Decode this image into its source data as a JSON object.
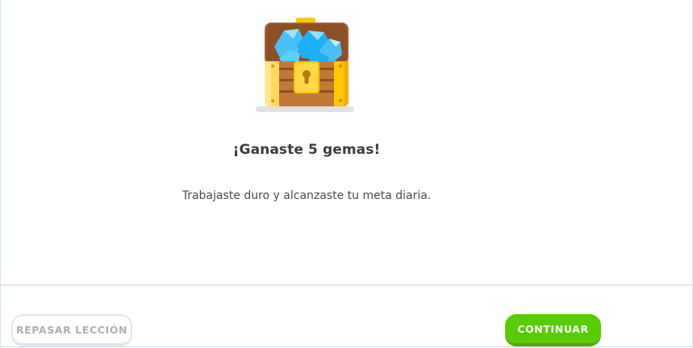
{
  "reward": {
    "illustration": "treasure-chest-with-gems",
    "title": "¡Ganaste 5 gemas!",
    "subtitle": "Trabajaste duro y alcanzaste tu meta diaria."
  },
  "footer": {
    "review_label": "REPASAR LECCIÓN",
    "continue_label": "CONTINUAR"
  },
  "colors": {
    "continue_button": "#58cc02",
    "continue_button_shadow": "#58a700",
    "text_primary": "#3c3c3c",
    "text_secondary": "#4b4b4b",
    "review_text": "#afafaf",
    "gem_blue": "#49c0f8"
  }
}
